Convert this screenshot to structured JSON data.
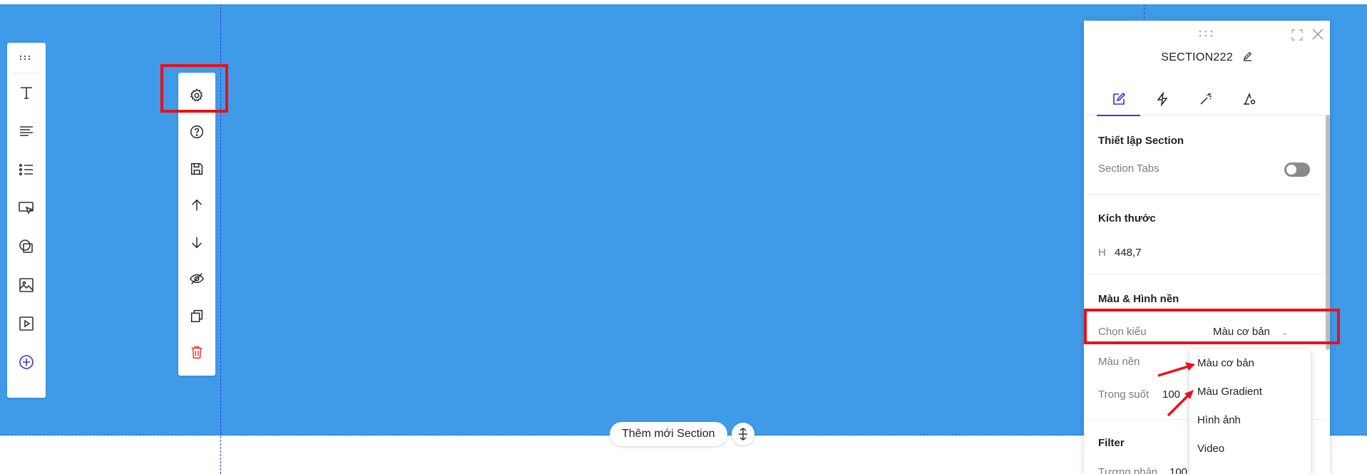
{
  "canvas": {
    "background": "#3f9ae8"
  },
  "left_toolbar": {
    "tools": [
      "text-icon",
      "paragraph-icon",
      "list-icon",
      "button-icon",
      "shape-icon",
      "image-icon",
      "video-icon",
      "add-icon"
    ]
  },
  "section_toolbar": {
    "buttons": [
      "gear-icon",
      "help-icon",
      "save-icon",
      "arrow-up-icon",
      "arrow-down-icon",
      "hide-icon",
      "duplicate-icon",
      "trash-icon"
    ]
  },
  "add_section": {
    "label": "Thêm mới Section"
  },
  "panel": {
    "title": "SECTION222",
    "tabs": [
      "edit-icon",
      "lightning-icon",
      "magic-icon",
      "settings-icon"
    ],
    "section_setup": {
      "title": "Thiết lập Section",
      "tabs_label": "Section Tabs"
    },
    "size": {
      "title": "Kích thước",
      "h_label": "H",
      "h_value": "448,7"
    },
    "color_bg": {
      "title": "Màu & Hình nền",
      "choose_label": "Chọn kiểu",
      "choose_value": "Màu cơ bản",
      "bg_label": "Màu nền",
      "opacity_label": "Trong suốt",
      "opacity_value": "100"
    },
    "filter": {
      "title": "Filter",
      "contrast_label": "Tương phản",
      "contrast_value": "100"
    }
  },
  "dropdown": {
    "options": [
      "Màu cơ bản",
      "Màu Gradient",
      "Hình ảnh",
      "Video"
    ]
  },
  "colors": {
    "highlight": "#e8111b",
    "accent": "#3b33d6",
    "danger": "#e53935"
  }
}
